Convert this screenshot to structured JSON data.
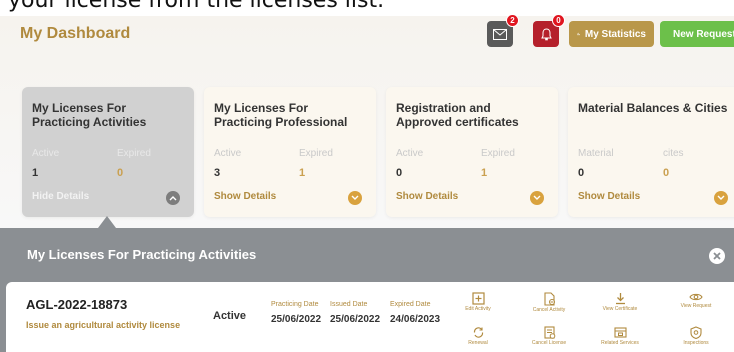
{
  "caption_text": "your license from the licenses list.",
  "header": {
    "title": "My Dashboard",
    "mail_badge": "2",
    "bell_badge": "0",
    "stats_label": "My Statistics",
    "new_request_label": "New Request"
  },
  "cards": [
    {
      "title": "My Licenses For Practicing Activities",
      "label1": "Active",
      "label2": "Expired",
      "value1": "1",
      "value2": "0",
      "details": "Hide Details",
      "selected": true
    },
    {
      "title": "My Licenses For Practicing Professional",
      "label1": "Active",
      "label2": "Expired",
      "value1": "3",
      "value2": "1",
      "details": "Show Details",
      "selected": false
    },
    {
      "title": "Registration and Approved certificates",
      "label1": "Active",
      "label2": "Expired",
      "value1": "0",
      "value2": "1",
      "details": "Show Details",
      "selected": false
    },
    {
      "title": "Material Balances & Cities",
      "label1": "Material",
      "label2": "cites",
      "value1": "0",
      "value2": "0",
      "details": "Show Details",
      "selected": false
    }
  ],
  "panel": {
    "title": "My Licenses For Practicing Activities",
    "license": {
      "id": "AGL-2022-18873",
      "description": "Issue an agricultural activity license",
      "status": "Active",
      "dates": [
        {
          "label": "Practicing Date",
          "value": "25/06/2022"
        },
        {
          "label": "Issued Date",
          "value": "25/06/2022"
        },
        {
          "label": "Expired Date",
          "value": "24/06/2023"
        }
      ],
      "actions": [
        {
          "label": "Edit Activity",
          "icon": "edit-activity-icon"
        },
        {
          "label": "Cancel Activity",
          "icon": "cancel-activity-icon"
        },
        {
          "label": "View Certificate",
          "icon": "download-certificate-icon"
        },
        {
          "label": "View Request",
          "icon": "eye-icon"
        },
        {
          "label": "Renewal",
          "icon": "renewal-icon"
        },
        {
          "label": "Cancel License",
          "icon": "cancel-license-icon"
        },
        {
          "label": "Related Services",
          "icon": "related-services-icon"
        },
        {
          "label": "Inspections",
          "icon": "shield-icon"
        }
      ]
    }
  },
  "colors": {
    "gold": "#b08a3e",
    "green": "#6cc04a",
    "red": "#b5202b",
    "panel_gray": "#8b8f93"
  }
}
